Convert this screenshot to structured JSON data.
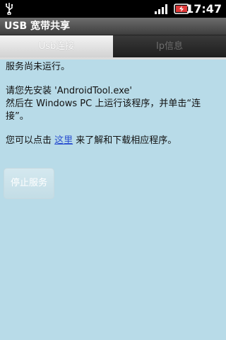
{
  "statusbar": {
    "time": "17:47"
  },
  "titlebar": {
    "title": "USB 宽带共享"
  },
  "tabs": [
    {
      "label": "Usb连接",
      "active": true
    },
    {
      "label": "Ip信息",
      "active": false
    }
  ],
  "content": {
    "status_text": "服务尚未运行。",
    "instruction_line1": "请您先安装 'AndroidTool.exe'",
    "instruction_line2": "然后在 Windows PC 上运行该程序，并单击“连",
    "instruction_line3": "接”。",
    "link_prefix": "您可以点击 ",
    "link_text": "这里",
    "link_suffix": " 来了解和下载相应程序。"
  },
  "buttons": {
    "stop_service": "停止服务"
  }
}
